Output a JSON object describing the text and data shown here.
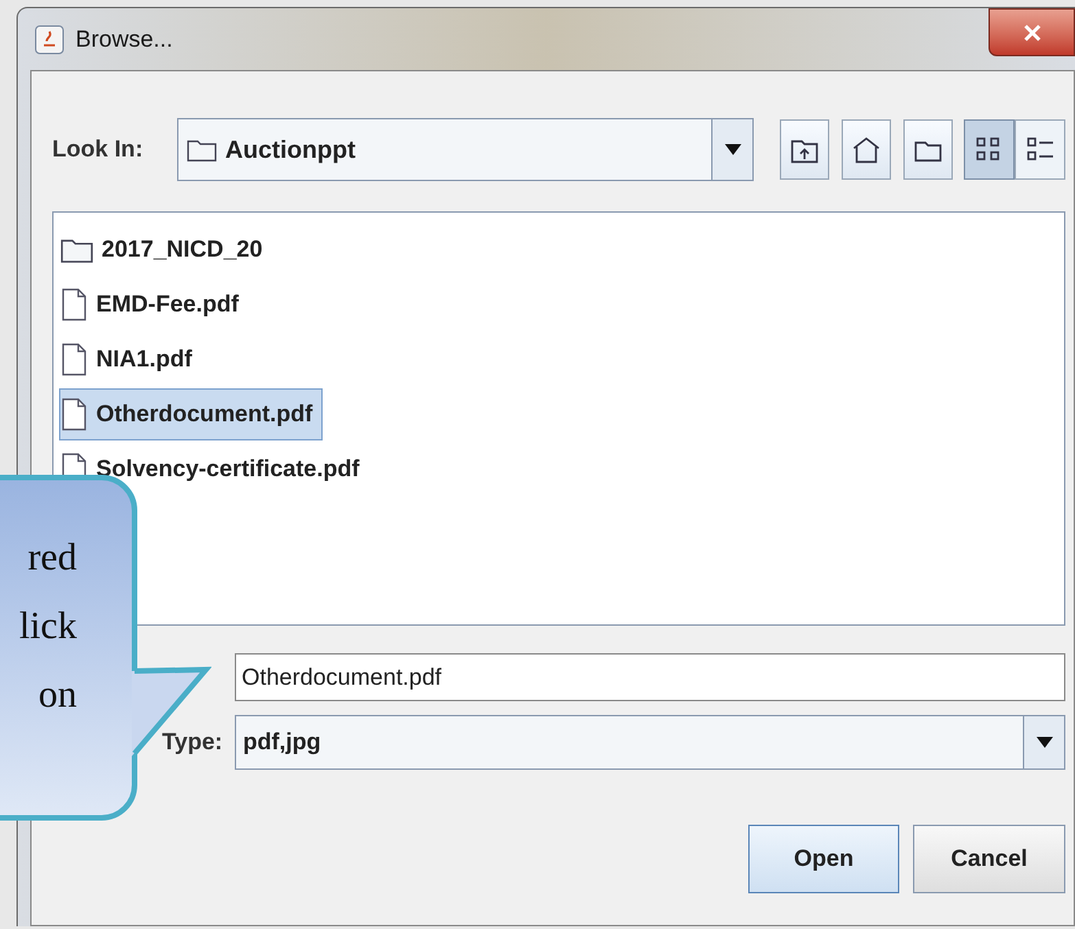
{
  "window": {
    "title": "Browse..."
  },
  "look_in": {
    "label": "Look In:",
    "value": "Auctionppt"
  },
  "tools": [
    {
      "kind": "up"
    },
    {
      "kind": "home"
    },
    {
      "kind": "new-folder"
    }
  ],
  "views": [
    {
      "kind": "list",
      "selected": true
    },
    {
      "kind": "details",
      "selected": false
    }
  ],
  "files": [
    {
      "name": "2017_NICD_20",
      "kind": "folder",
      "selected": false
    },
    {
      "name": "EMD-Fee.pdf",
      "kind": "file",
      "selected": false
    },
    {
      "name": "NIA1.pdf",
      "kind": "file",
      "selected": false
    },
    {
      "name": "Otherdocument.pdf",
      "kind": "file",
      "selected": true
    },
    {
      "name": "Solvency-certificate.pdf",
      "kind": "file",
      "selected": false
    }
  ],
  "file_name": {
    "value": "Otherdocument.pdf"
  },
  "file_type": {
    "label": "Type:",
    "value": "pdf,jpg"
  },
  "buttons": [
    "Open",
    "Cancel"
  ],
  "callout": {
    "lines": [
      "red",
      "lick",
      "on"
    ]
  }
}
